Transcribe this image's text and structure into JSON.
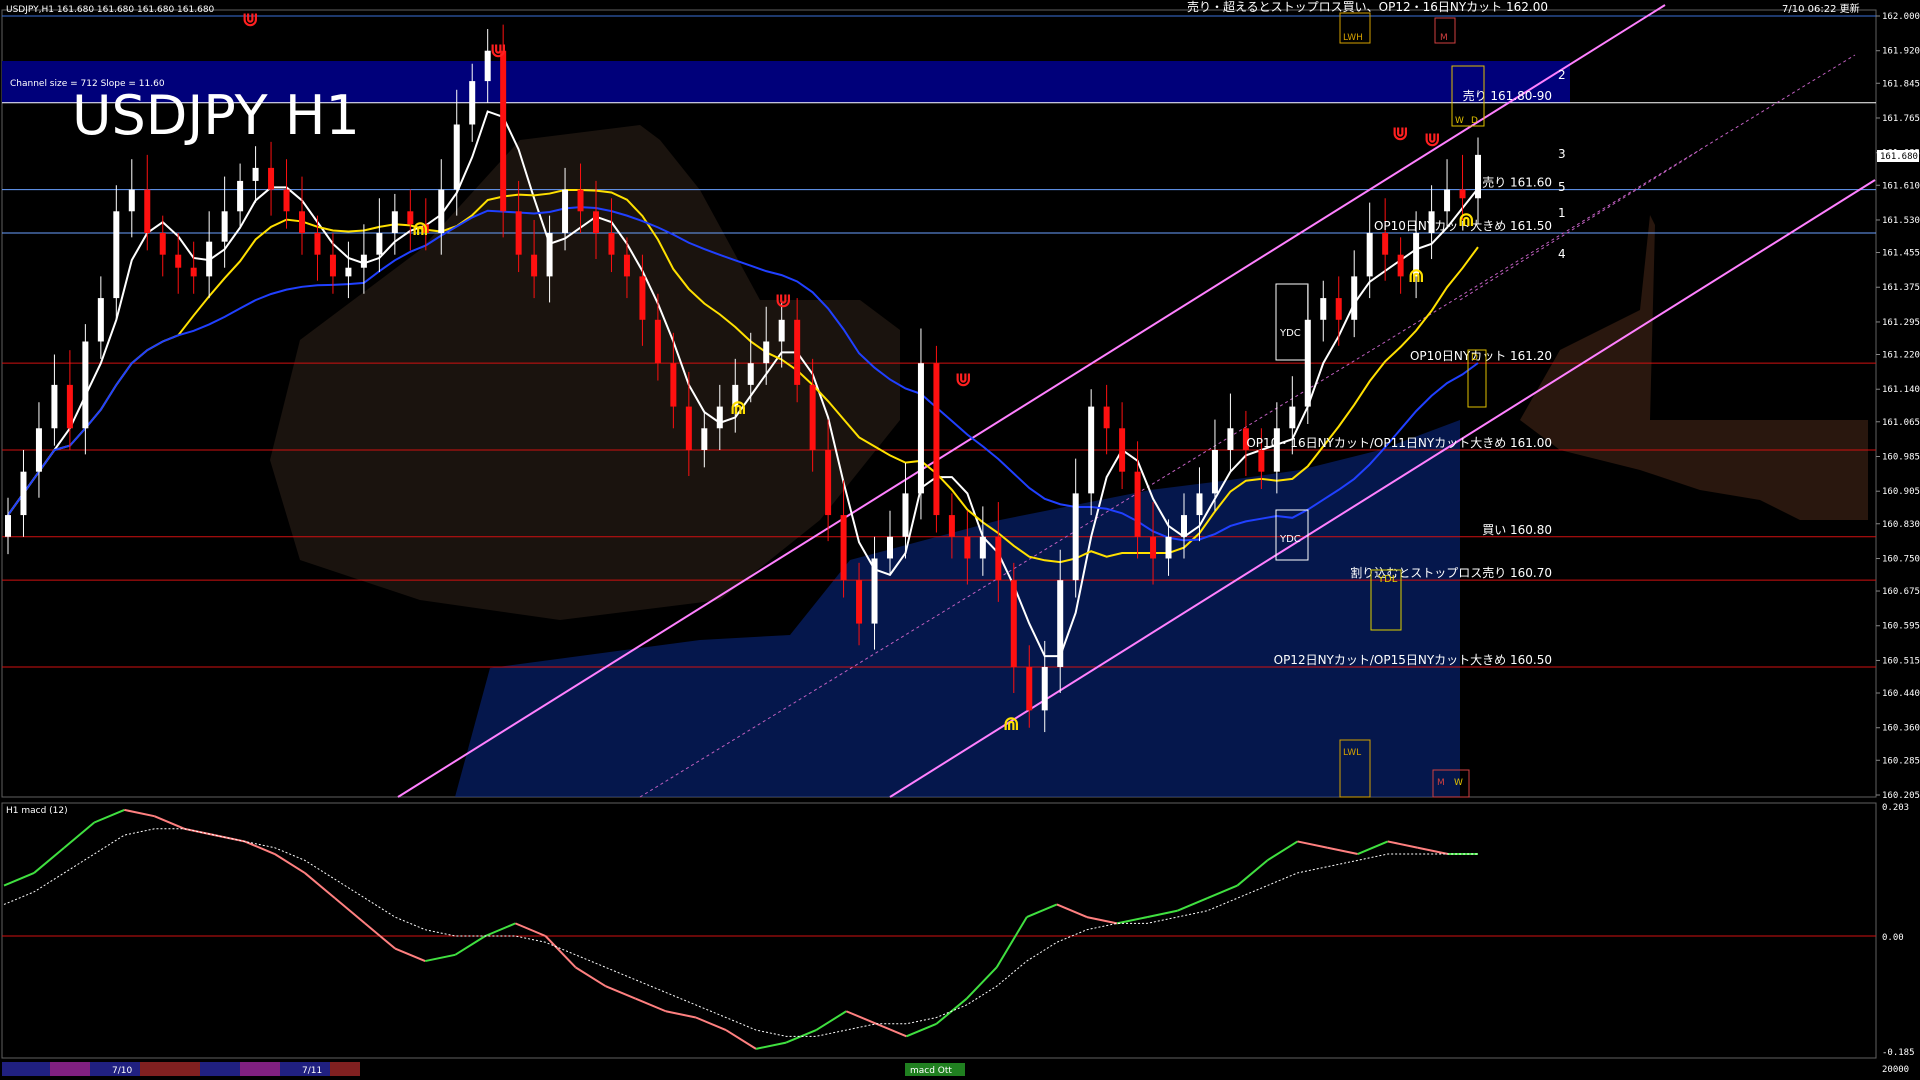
{
  "window": {
    "title_left": "USDJPY,H1  161.680 161.680 161.680 161.680",
    "title_right": "7/10 06:22 更新",
    "main_label": "USDJPY H1",
    "channel_info": "Channel size = 712 Slope = 11.60"
  },
  "top_banner": {
    "text": "売り・超えるとストップロス買い、OP12・16日NYカット 162.00"
  },
  "price_axis": {
    "labels": [
      "162.000",
      "161.920",
      "161.845",
      "161.765",
      "161.685",
      "161.610",
      "161.530",
      "161.455",
      "161.375",
      "161.295",
      "161.220",
      "161.140",
      "161.065",
      "160.985",
      "160.905",
      "160.830",
      "160.750",
      "160.675",
      "160.595",
      "160.515",
      "160.440",
      "160.360",
      "160.285",
      "160.205"
    ],
    "current_price": "161.680"
  },
  "levels": [
    {
      "price": 162.0,
      "label": "売り・超えるとストップロス買い、OP12・16日NYカット 162.00",
      "color": "#3a6fd8"
    },
    {
      "price": 161.8,
      "label": "売り 161.80-90",
      "color": "#ffffff"
    },
    {
      "price": 161.6,
      "label": "売り 161.60",
      "color": "#6aa0ff"
    },
    {
      "price": 161.5,
      "label": "OP10日NYカット大きめ 161.50",
      "color": "#6aa0ff"
    },
    {
      "price": 161.2,
      "label": "OP10日NYカット 161.20",
      "color": "#d01010"
    },
    {
      "price": 161.0,
      "label": "OP10・16日NYカット/OP11日NYカット大きめ 161.00",
      "color": "#d01010"
    },
    {
      "price": 160.8,
      "label": "買い 160.80",
      "color": "#d01010"
    },
    {
      "price": 160.7,
      "label": "割り込むとストップロス売り 160.70",
      "color": "#d01010"
    },
    {
      "price": 160.5,
      "label": "OP12日NYカット/OP15日NYカット大きめ 160.50",
      "color": "#d01010"
    }
  ],
  "channel_labels": [
    "2",
    "3",
    "5",
    "1",
    "4"
  ],
  "markers": {
    "ydc": "YDC",
    "ydl": "YDL",
    "lwh": "LWH",
    "lwl": "LWL",
    "m": "M",
    "w": "W",
    "d": "D"
  },
  "macd": {
    "title": "H1  macd (12)",
    "axis": [
      "0.203",
      "0.00",
      "-0.185"
    ],
    "axis_bottom": "20000"
  },
  "date_bar": {
    "labels": [
      "7/10",
      "7/11"
    ],
    "tab": "macd Ott"
  },
  "chart_data": {
    "type": "candlestick",
    "title": "USDJPY H1",
    "ylim": [
      160.205,
      162.0
    ],
    "y_ticks": [
      162.0,
      161.92,
      161.845,
      161.765,
      161.685,
      161.61,
      161.53,
      161.455,
      161.375,
      161.295,
      161.22,
      161.14,
      161.065,
      160.985,
      160.905,
      160.83,
      160.75,
      160.675,
      160.595,
      160.515,
      160.44,
      160.36,
      160.285,
      160.205
    ],
    "current_price": 161.68,
    "closes": [
      160.85,
      160.95,
      161.05,
      161.15,
      161.05,
      161.25,
      161.35,
      161.55,
      161.6,
      161.5,
      161.45,
      161.42,
      161.4,
      161.48,
      161.55,
      161.62,
      161.65,
      161.6,
      161.55,
      161.5,
      161.45,
      161.4,
      161.42,
      161.45,
      161.5,
      161.55,
      161.52,
      161.5,
      161.6,
      161.75,
      161.85,
      161.92,
      161.55,
      161.45,
      161.4,
      161.5,
      161.6,
      161.55,
      161.5,
      161.45,
      161.4,
      161.3,
      161.2,
      161.1,
      161.0,
      161.05,
      161.1,
      161.15,
      161.2,
      161.25,
      161.3,
      161.15,
      161.0,
      160.85,
      160.7,
      160.6,
      160.75,
      160.8,
      160.9,
      161.2,
      160.85,
      160.8,
      160.75,
      160.8,
      160.7,
      160.5,
      160.4,
      160.5,
      160.7,
      160.9,
      161.1,
      161.05,
      160.95,
      160.8,
      160.75,
      160.8,
      160.85,
      160.9,
      161.0,
      161.05,
      161.0,
      160.95,
      161.05,
      161.1,
      161.3,
      161.35,
      161.3,
      161.4,
      161.5,
      161.45,
      161.4,
      161.5,
      161.55,
      161.6,
      161.58,
      161.68
    ],
    "indicator_series": [
      {
        "name": "macd (12)",
        "panel": "lower",
        "values": [
          0.08,
          0.1,
          0.14,
          0.18,
          0.2,
          0.19,
          0.17,
          0.16,
          0.15,
          0.13,
          0.1,
          0.06,
          0.02,
          -0.02,
          -0.04,
          -0.03,
          0.0,
          0.02,
          0.0,
          -0.05,
          -0.08,
          -0.1,
          -0.12,
          -0.13,
          -0.15,
          -0.18,
          -0.17,
          -0.15,
          -0.12,
          -0.14,
          -0.16,
          -0.14,
          -0.1,
          -0.05,
          0.03,
          0.05,
          0.03,
          0.02,
          0.03,
          0.04,
          0.06,
          0.08,
          0.12,
          0.15,
          0.14,
          0.13,
          0.15,
          0.14,
          0.13,
          0.13
        ]
      },
      {
        "name": "signal",
        "panel": "lower",
        "values": [
          0.05,
          0.07,
          0.1,
          0.13,
          0.16,
          0.17,
          0.17,
          0.16,
          0.15,
          0.14,
          0.12,
          0.09,
          0.06,
          0.03,
          0.01,
          0.0,
          0.0,
          0.0,
          -0.01,
          -0.03,
          -0.05,
          -0.07,
          -0.09,
          -0.11,
          -0.13,
          -0.15,
          -0.16,
          -0.16,
          -0.15,
          -0.14,
          -0.14,
          -0.13,
          -0.11,
          -0.08,
          -0.04,
          -0.01,
          0.01,
          0.02,
          0.02,
          0.03,
          0.04,
          0.06,
          0.08,
          0.1,
          0.11,
          0.12,
          0.13,
          0.13,
          0.13,
          0.13
        ]
      }
    ]
  }
}
